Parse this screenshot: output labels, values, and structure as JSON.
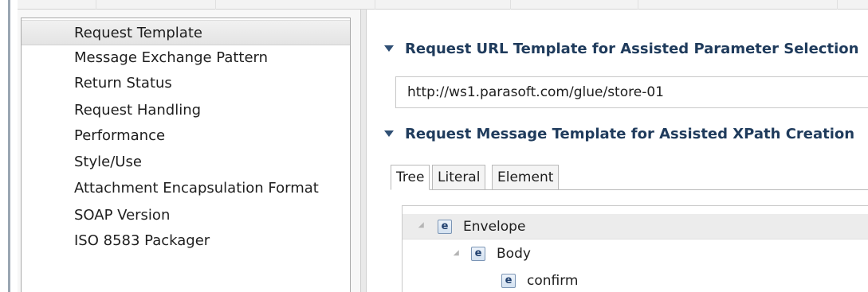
{
  "nav": {
    "items": [
      {
        "label": "Request Template",
        "selected": true
      },
      {
        "label": "Message Exchange Pattern"
      },
      {
        "label": "Return Status"
      },
      {
        "label": "Request Handling"
      },
      {
        "label": "Performance"
      },
      {
        "label": "Style/Use"
      },
      {
        "label": "Attachment Encapsulation Format"
      },
      {
        "label": "SOAP Version"
      },
      {
        "label": "ISO 8583 Packager"
      }
    ]
  },
  "url_section": {
    "title": "Request URL Template for Assisted Parameter Selection",
    "url_value": "http://ws1.parasoft.com/glue/store-01"
  },
  "message_section": {
    "title": "Request Message Template for Assisted XPath Creation",
    "tabs": [
      "Tree",
      "Literal",
      "Element"
    ],
    "active_tab": "Tree"
  },
  "tree": {
    "nodes": [
      {
        "icon": "element-icon",
        "badge": "e",
        "label": "Envelope",
        "expander": true
      },
      {
        "icon": "element-icon",
        "badge": "e",
        "label": "Body",
        "expander": true
      },
      {
        "icon": "element-icon",
        "badge": "e",
        "label": "confirm",
        "expander": false
      }
    ]
  },
  "colors": {
    "section_title": "#1f3b5c",
    "selection_bg": "#ececec",
    "element_icon_border": "#7b95b5"
  }
}
